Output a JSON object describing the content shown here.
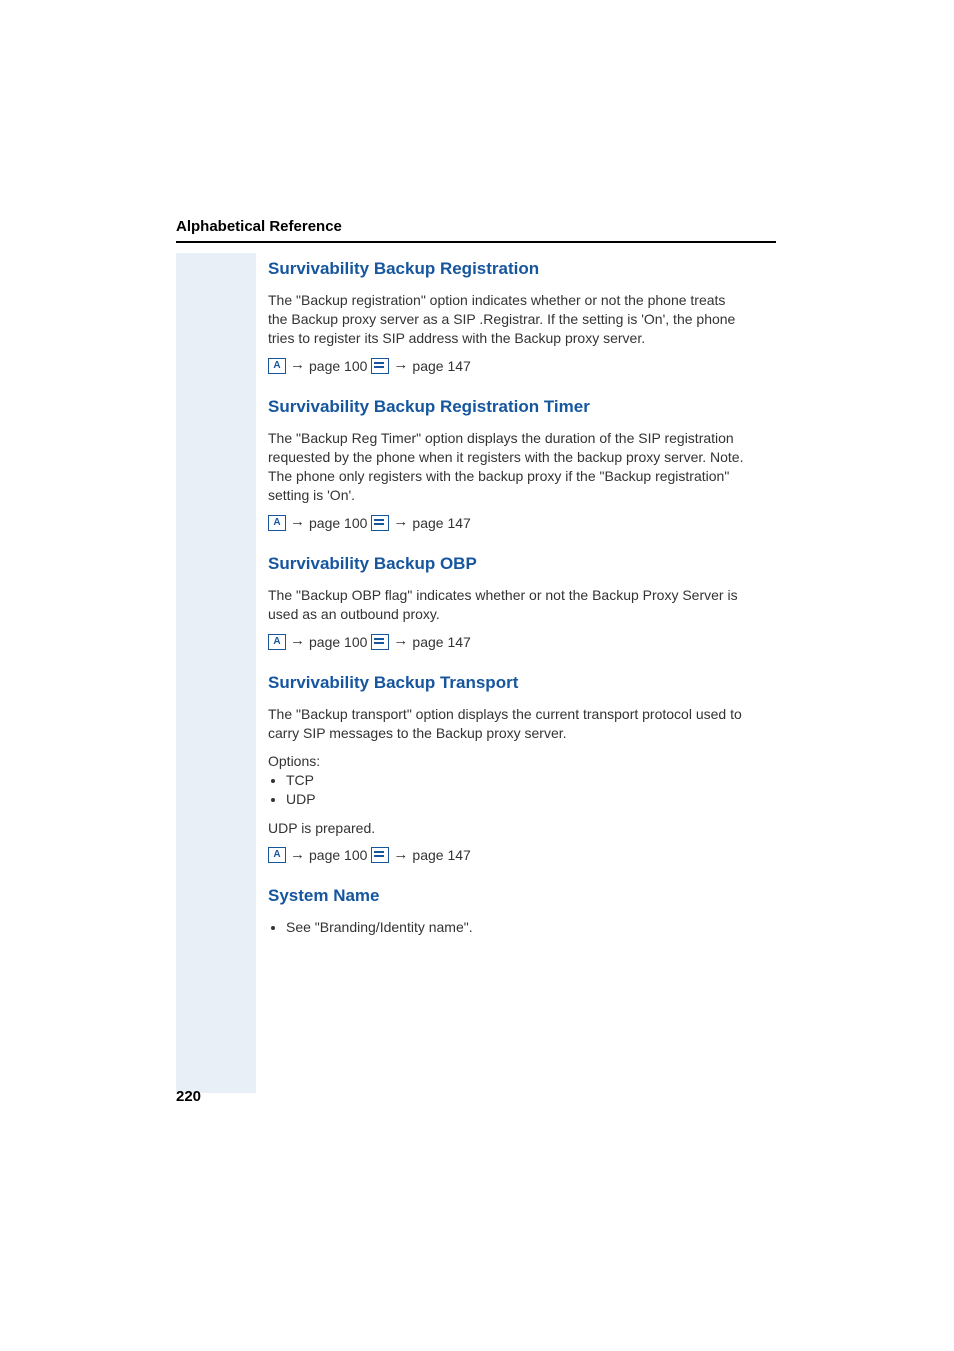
{
  "header": {
    "title": "Alphabetical Reference"
  },
  "page_number": "220",
  "ref": {
    "arrow": "→",
    "page100": "page 100",
    "page147": "page 147",
    "iconA": "A"
  },
  "sections": [
    {
      "heading": "Survivability Backup Registration",
      "body": "The \"Backup registration\" option indicates whether or not the phone treats the Backup proxy server as a SIP .Registrar. If the setting is 'On', the phone tries to register its SIP address with the Backup proxy server."
    },
    {
      "heading": "Survivability Backup Registration Timer",
      "body": "The \"Backup Reg Timer\" option displays the duration of the SIP registration requested by the phone when it registers with the backup proxy server. Note. The phone only registers with the backup proxy if the \"Backup registration\" setting is 'On'."
    },
    {
      "heading": "Survivability Backup OBP",
      "body": "The \"Backup OBP flag\" indicates whether or not the Backup Proxy Server is used as an outbound proxy."
    },
    {
      "heading": "Survivability Backup Transport",
      "body": "The \"Backup transport\" option displays the current transport protocol used to carry SIP messages to the Backup proxy server.",
      "options_label": "Options:",
      "options": [
        "TCP",
        "UDP"
      ],
      "extra": "UDP is prepared."
    },
    {
      "heading": "System Name",
      "see": "See \"Branding/Identity name\"."
    }
  ]
}
